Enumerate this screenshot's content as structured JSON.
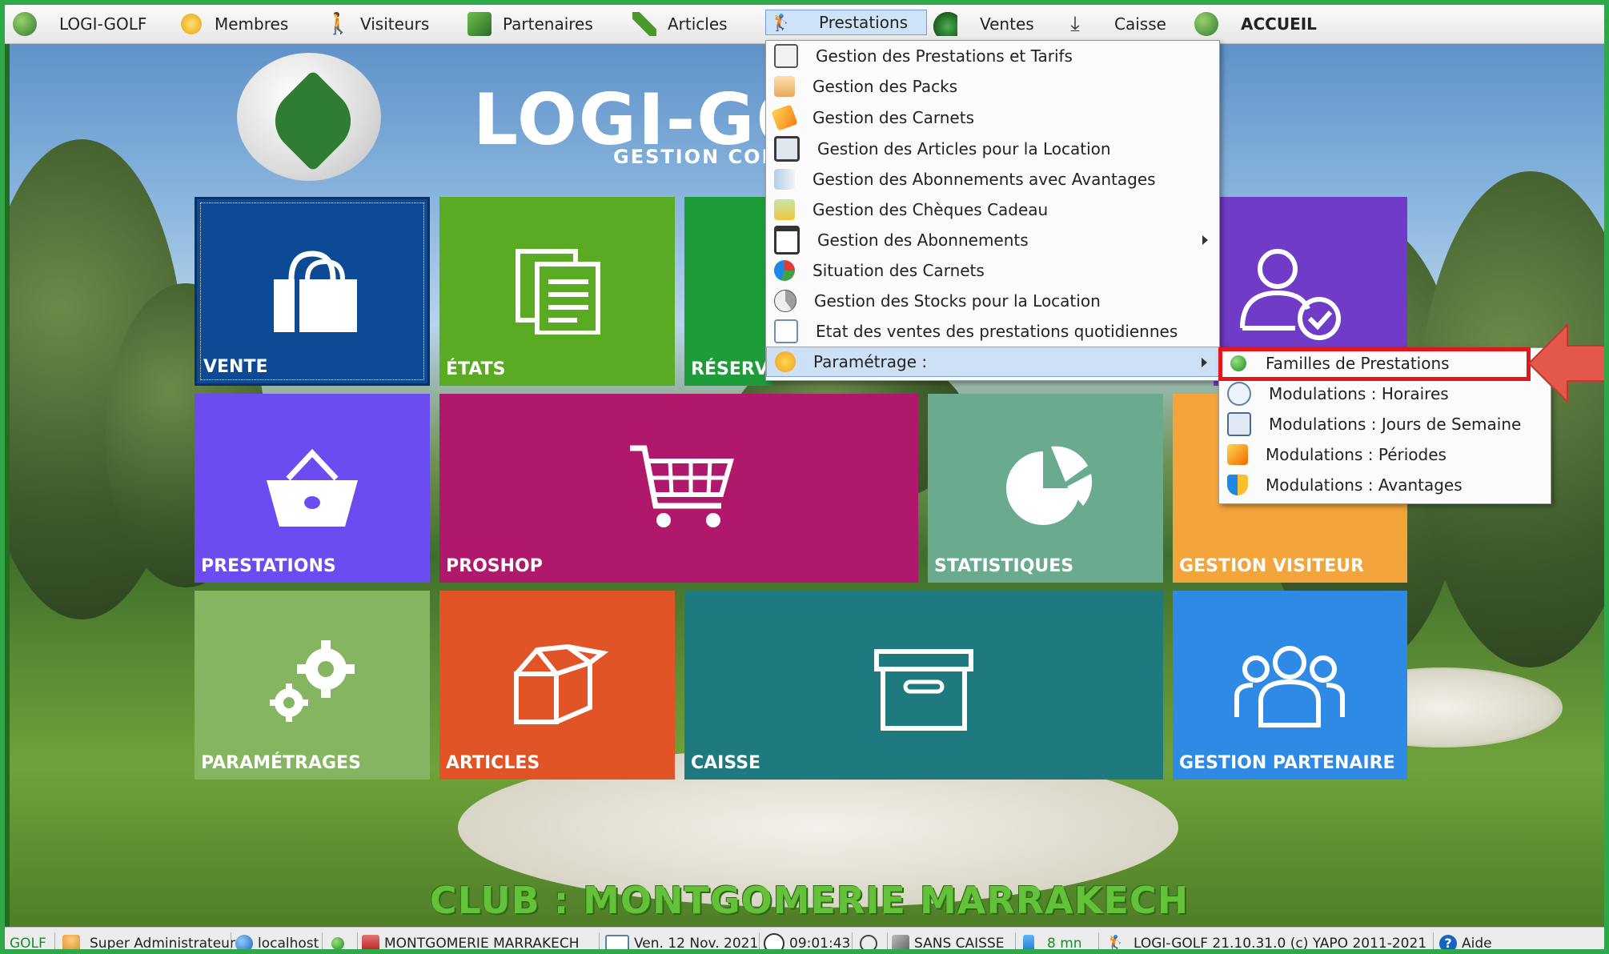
{
  "menubar": {
    "items": [
      {
        "label": "LOGI-GOLF",
        "icon": "golf-ball-icon"
      },
      {
        "label": "Membres",
        "icon": "members-icon"
      },
      {
        "label": "Visiteurs",
        "icon": "visitor-icon"
      },
      {
        "label": "Partenaires",
        "icon": "partner-icon"
      },
      {
        "label": "Articles",
        "icon": "pen-icon"
      },
      {
        "label": "Prestations",
        "icon": "golfer-icon"
      },
      {
        "label": "Ventes",
        "icon": "sales-icon"
      },
      {
        "label": "Caisse",
        "icon": "download-icon"
      },
      {
        "label": "ACCUEIL",
        "icon": "home-icon"
      }
    ]
  },
  "brand": {
    "title": "LOGI-GO",
    "subtitle": "GESTION COM"
  },
  "tiles": {
    "vente": "VENTE",
    "etats": "ÉTATS",
    "reservations": "RÉSERVA",
    "prestations": "PRESTATIONS",
    "proshop": "PROSHOP",
    "statistiques": "STATISTIQUES",
    "gestion_visiteur": "GESTION VISITEUR",
    "parametrages": "PARAMÉTRAGES",
    "articles": "ARTICLES",
    "caisse": "CAISSE",
    "gestion_partenaire": "GESTION PARTENAIRE"
  },
  "prestations_menu": {
    "items": [
      {
        "label": "Gestion des Prestations et Tarifs",
        "icon": "clipboard-icon"
      },
      {
        "label": "Gestion des Packs",
        "icon": "pack-icon"
      },
      {
        "label": "Gestion des Carnets",
        "icon": "ticket-icon"
      },
      {
        "label": "Gestion des Articles pour la Location",
        "icon": "rental-icon"
      },
      {
        "label": "Gestion des Abonnements avec Avantages",
        "icon": "subscription-advantage-icon"
      },
      {
        "label": "Gestion des Chèques Cadeau",
        "icon": "gift-check-icon"
      },
      {
        "label": "Gestion des Abonnements",
        "icon": "calendar-icon",
        "submenu": true
      },
      {
        "label": "Situation des Carnets",
        "icon": "pie-chart-icon"
      },
      {
        "label": "Gestion des Stocks pour la Location",
        "icon": "stock-icon"
      },
      {
        "label": "Etat des ventes des prestations quotidiennes",
        "icon": "document-icon"
      },
      {
        "label": "Paramétrage :",
        "icon": "settings-icon",
        "submenu": true
      }
    ]
  },
  "parametrage_submenu": {
    "items": [
      {
        "label": "Familles de Prestations",
        "icon": "green-dot-icon"
      },
      {
        "label": "Modulations : Horaires",
        "icon": "clock-icon"
      },
      {
        "label": "Modulations : Jours de Semaine",
        "icon": "weekday-calendar-icon"
      },
      {
        "label": "Modulations : Périodes",
        "icon": "period-icon"
      },
      {
        "label": "Modulations : Avantages",
        "icon": "shield-icon"
      }
    ]
  },
  "club": {
    "text": "CLUB : MONTGOMERIE MARRAKECH"
  },
  "statusbar": {
    "app": "GOLF",
    "user": "Super Administrateur",
    "host": "localhost",
    "site": "MONTGOMERIE MARRAKECH",
    "date": "Ven. 12 Nov. 2021",
    "time": "09:01:43",
    "caisse": "SANS CAISSE",
    "duration": "8 mn",
    "version": "LOGI-GOLF 21.10.31.0 (c) YAPO 2011-2021",
    "help": "Aide"
  },
  "colors": {
    "frame": "#2fa84a",
    "vente": "#0d4a96",
    "etats": "#5aab23",
    "reservations": "#1e9c3a",
    "gestion_membre": "#6f3bc7",
    "prestations": "#6a4cf0",
    "proshop": "#b0186b",
    "statistiques": "#6aab90",
    "gestion_visiteur": "#f3a43a",
    "parametrages": "#86b562",
    "articles": "#e15427",
    "caisse": "#1f7a80",
    "gestion_partenaire": "#2f8ae6",
    "highlight": "#e3161b"
  }
}
